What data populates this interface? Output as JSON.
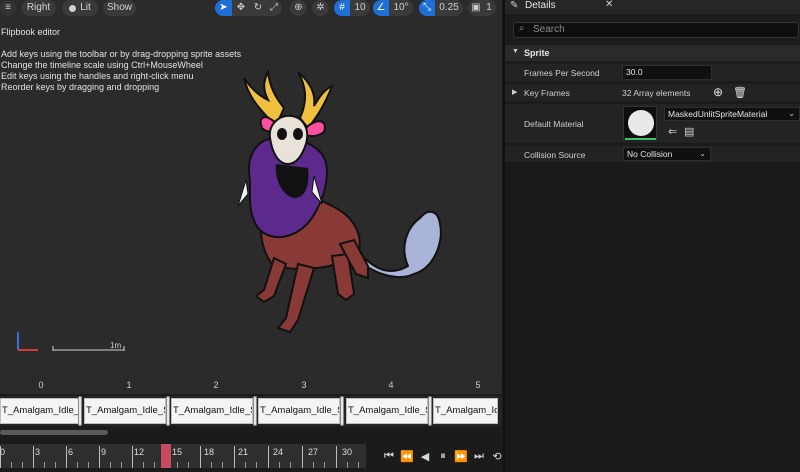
{
  "toolbar": {
    "view_mode": "Right",
    "lighting": "Lit",
    "show": "Show",
    "grid_snap_value": "10",
    "rotation_snap_value": "10°",
    "scale_snap_value": "0.25",
    "camera_speed": "1"
  },
  "viewport": {
    "title": "Flipbook editor",
    "help_lines": [
      "Add keys using the toolbar or by drag-dropping sprite assets",
      "Change the timeline scale using Ctrl+MouseWheel",
      "Edit keys using the handles and right-click menu",
      "Reorder keys by dragging and dropping"
    ],
    "scale_label": "1m"
  },
  "timeline": {
    "frame_numbers": [
      "0",
      "1",
      "2",
      "3",
      "4",
      "5"
    ],
    "keyframes": [
      "T_Amalgam_Idle_Sprite",
      "T_Amalgam_Idle_Sprite",
      "T_Amalgam_Idle_Sprite",
      "T_Amalgam_Idle_Sprite",
      "T_Amalgam_Idle_Sprite",
      "T_Amalgam_Idle_Sprite"
    ],
    "ruler_labels": [
      "0",
      "3",
      "6",
      "9",
      "12",
      "15",
      "18",
      "21",
      "24",
      "27",
      "30"
    ],
    "current_frame": 15
  },
  "details": {
    "title": "Details",
    "search_placeholder": "Search",
    "section": "Sprite",
    "frames_per_second_label": "Frames Per Second",
    "frames_per_second_value": "30.0",
    "key_frames_label": "Key Frames",
    "key_frames_value": "32 Array elements",
    "default_material_label": "Default Material",
    "default_material_value": "MaskedUnlitSpriteMaterial",
    "collision_source_label": "Collision Source",
    "collision_source_value": "No Collision"
  },
  "colors": {
    "accent": "#1e6fd6",
    "playhead": "#c74b60"
  }
}
